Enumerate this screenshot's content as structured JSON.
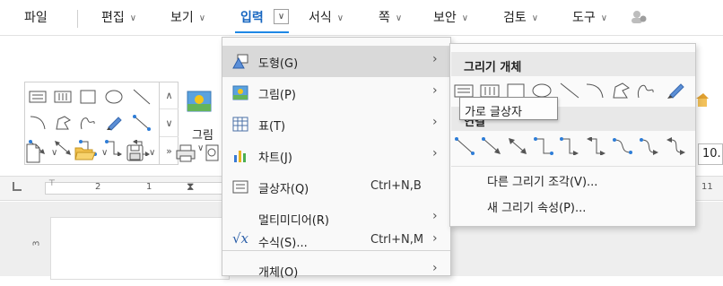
{
  "menubar": {
    "tabs": [
      {
        "label": "파일"
      },
      {
        "label": "편집"
      },
      {
        "label": "보기"
      },
      {
        "label": "입력"
      },
      {
        "label": "서식"
      },
      {
        "label": "쪽"
      },
      {
        "label": "보안"
      },
      {
        "label": "검토"
      },
      {
        "label": "도구"
      }
    ]
  },
  "ribbon": {
    "picture_label": "그림",
    "font_size_value": "10."
  },
  "ruler": {
    "marks": [
      "2",
      "1",
      "11"
    ],
    "vertical_mark": "3"
  },
  "insert_menu": {
    "items": [
      {
        "label": "도형(G)",
        "shortcut": "",
        "icon": "shape-icon",
        "has_submenu": true
      },
      {
        "label": "그림(P)",
        "shortcut": "",
        "icon": "picture-icon",
        "has_submenu": true
      },
      {
        "label": "표(T)",
        "shortcut": "",
        "icon": "table-icon",
        "has_submenu": true
      },
      {
        "label": "차트(J)",
        "shortcut": "",
        "icon": "chart-icon",
        "has_submenu": true
      },
      {
        "label": "글상자(Q)",
        "shortcut": "Ctrl+N,B",
        "icon": "textbox-icon",
        "has_submenu": false
      },
      {
        "label": "멀티미디어(R)",
        "shortcut": "",
        "icon": "",
        "has_submenu": true
      },
      {
        "label": "수식(S)...",
        "shortcut": "Ctrl+N,M",
        "icon": "formula-icon",
        "has_submenu": true
      },
      {
        "label": "개체(O)",
        "shortcut": "",
        "icon": "",
        "has_submenu": true
      }
    ]
  },
  "shape_submenu": {
    "section1_title": "그리기 개체",
    "section2_title": "연결",
    "other_piece": "다른 그리기 조각(V)...",
    "new_property": "새 그리기 속성(P)..."
  },
  "tooltip": {
    "text": "가로 글상자"
  },
  "colors": {
    "accent": "#1e88e5",
    "active_tab": "#1565c0",
    "highlight": "#d9d9d9"
  }
}
